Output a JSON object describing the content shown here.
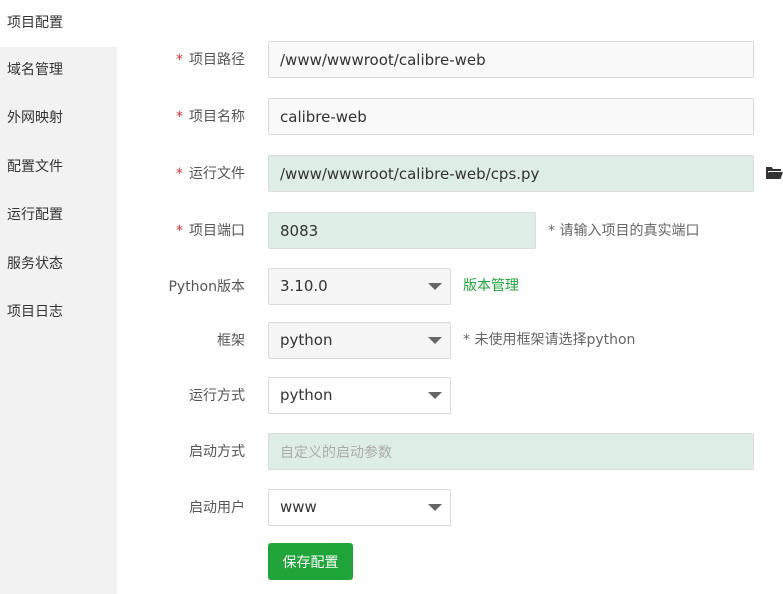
{
  "sidebar": {
    "items": [
      {
        "label": "项目配置"
      },
      {
        "label": "域名管理"
      },
      {
        "label": "外网映射"
      },
      {
        "label": "配置文件"
      },
      {
        "label": "运行配置"
      },
      {
        "label": "服务状态"
      },
      {
        "label": "项目日志"
      }
    ]
  },
  "form": {
    "required_mark": "*",
    "project_path": {
      "label": "项目路径",
      "value": "/www/wwwroot/calibre-web"
    },
    "project_name": {
      "label": "项目名称",
      "value": "calibre-web"
    },
    "run_file": {
      "label": "运行文件",
      "value": "/www/wwwroot/calibre-web/cps.py"
    },
    "project_port": {
      "label": "项目端口",
      "value": "8083",
      "hint": "* 请输入项目的真实端口"
    },
    "python_version": {
      "label": "Python版本",
      "value": "3.10.0",
      "link": "版本管理"
    },
    "framework": {
      "label": "框架",
      "value": "python",
      "hint": "* 未使用框架请选择python"
    },
    "run_mode": {
      "label": "运行方式",
      "value": "python"
    },
    "start_mode": {
      "label": "启动方式",
      "placeholder": "自定义的启动参数"
    },
    "start_user": {
      "label": "启动用户",
      "value": "www"
    },
    "save_label": "保存配置"
  },
  "icons": {
    "folder": "folder-open-icon",
    "caret": "caret-down-icon"
  },
  "colors": {
    "accent": "#20a53a",
    "required": "#e5322d",
    "highlight_input": "#deeee6",
    "sidebar_bg": "#f2f2f2"
  }
}
